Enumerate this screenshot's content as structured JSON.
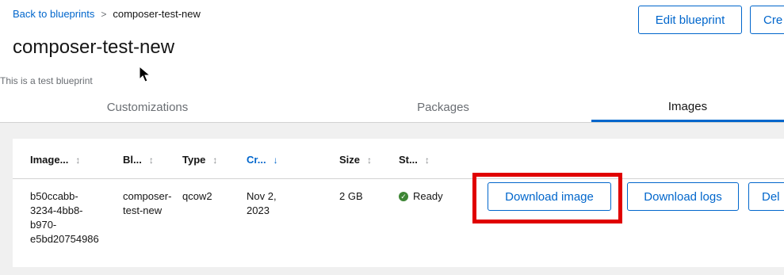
{
  "breadcrumb": {
    "back_label": "Back to blueprints",
    "separator": ">",
    "current": "composer-test-new"
  },
  "actions": {
    "edit_label": "Edit blueprint",
    "create_label": "Cre"
  },
  "page": {
    "title": "composer-test-new",
    "description": "This is a test blueprint"
  },
  "tabs": [
    {
      "label": "Customizations"
    },
    {
      "label": "Packages"
    },
    {
      "label": "Images"
    }
  ],
  "table": {
    "headers": [
      {
        "label": "Image..."
      },
      {
        "label": "Bl..."
      },
      {
        "label": "Type"
      },
      {
        "label": "Cr..."
      },
      {
        "label": "Size"
      },
      {
        "label": "St..."
      }
    ],
    "rows": [
      {
        "image_lines": [
          "b50ccabb-",
          "3234-4bb8-",
          "b970-",
          "e5bd20754986"
        ],
        "blueprint_lines": [
          "composer-",
          "test-new"
        ],
        "type": "qcow2",
        "created_lines": [
          "Nov 2,",
          "2023"
        ],
        "size": "2 GB",
        "status": "Ready",
        "download_image_label": "Download image",
        "download_logs_label": "Download logs",
        "delete_label": "Del"
      }
    ]
  },
  "colors": {
    "accent": "#0066cc",
    "highlight": "#e00000",
    "ready": "#3e8635"
  }
}
